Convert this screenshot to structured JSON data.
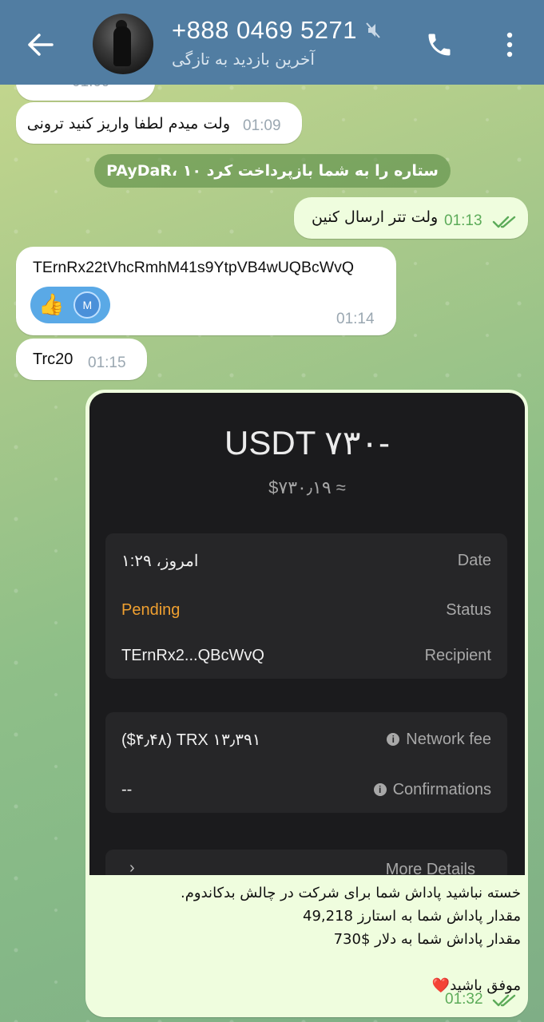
{
  "header": {
    "contact_name": "+888 0469 5271",
    "status": "آخرین بازدید به تازگی",
    "icons": [
      "back-arrow-icon",
      "muted-icon",
      "phone-icon",
      "more-vert-icon"
    ]
  },
  "colors": {
    "header": "#517da2",
    "outgoing": "#effdde",
    "check": "#5cab59",
    "pending": "#f0a030"
  },
  "messages": {
    "partial_time": "01:09",
    "m1": {
      "text": "ولت میدم لطفا واریز کنید ترونی",
      "time": "01:09"
    },
    "service": "PAyDaR، ۱۰ ستاره را به شما بازپرداخت کرد",
    "m2": {
      "text": "ولت تتر ارسال کنین",
      "time": "01:13"
    },
    "m3": {
      "text": "TErnRx22tVhcRmhM41s9YtpVB4wUQBcWvQ",
      "time": "01:14",
      "reaction_emoji": "👍",
      "reaction_avatar": "M"
    },
    "m4": {
      "text": "Trc20",
      "time": "01:15"
    },
    "m5": {
      "amount": "USDT ۷۳۰-",
      "amount_usd": "$۷۳۰٫۱۹ ≈",
      "rows": [
        {
          "label": "Date",
          "value": "امروز، ۱:۲۹"
        },
        {
          "label": "Status",
          "value": "Pending"
        },
        {
          "label": "Recipient",
          "value": "TErnRx2...QBcWvQ"
        }
      ],
      "fee_rows": [
        {
          "label": "Network fee",
          "value": "($۴٫۴۸) TRX ۱۳٫۳۹۱"
        },
        {
          "label": "Confirmations",
          "value": "--"
        }
      ],
      "more_label": "More Details",
      "caption_lines": [
        "خسته نباشید پاداش شما برای شرکت در چالش بدکاندوم.",
        "مقدار پاداش شما به استارز  49,218",
        "مقدار پاداش شما به دلار $730",
        "",
        "موفق باشید❤️"
      ],
      "time": "01:32"
    }
  }
}
